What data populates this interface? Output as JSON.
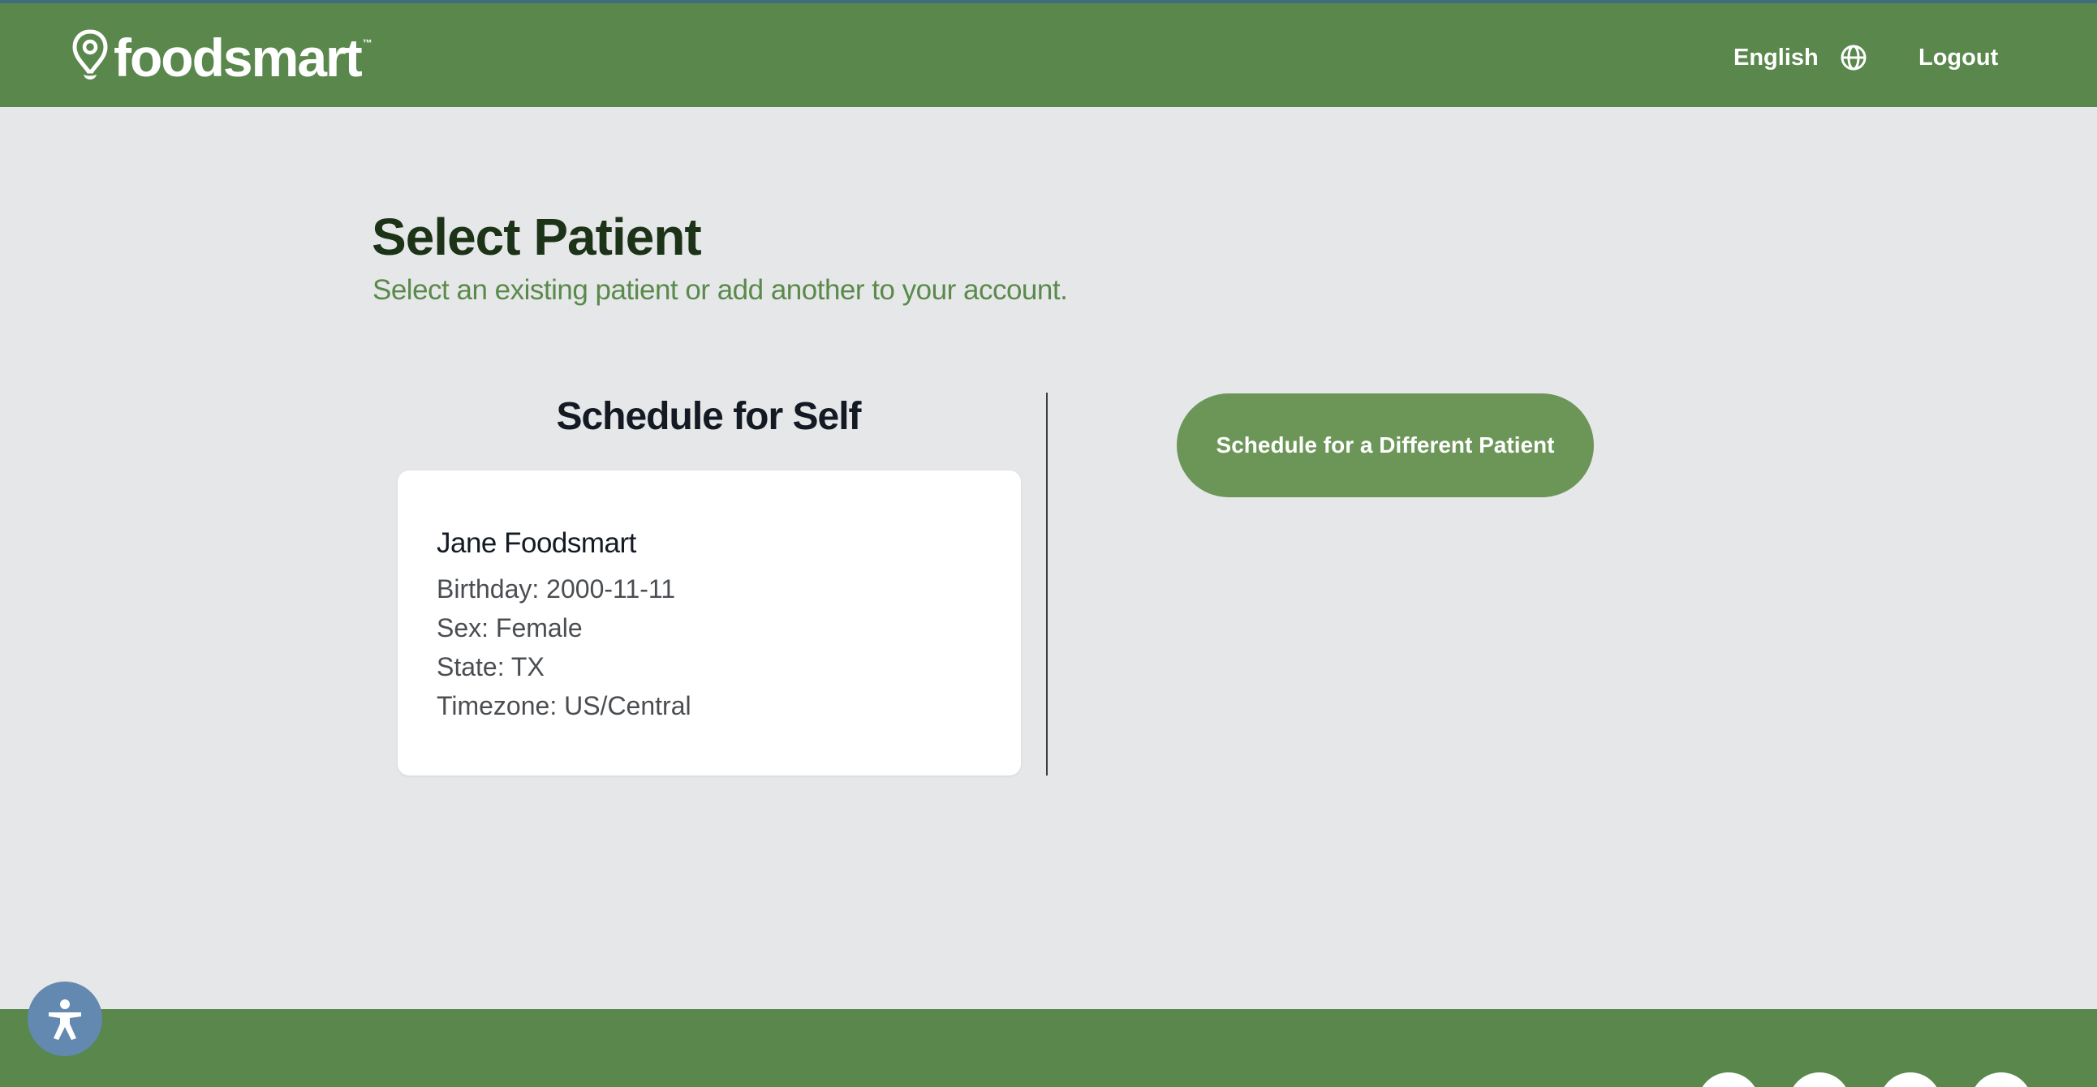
{
  "header": {
    "logo_text": "foodsmart",
    "logo_tm": "™",
    "language_label": "English",
    "logout_label": "Logout"
  },
  "main": {
    "title": "Select Patient",
    "subtitle": "Select an existing patient or add another to your account.",
    "self_section": {
      "heading": "Schedule for Self",
      "patient": {
        "name": "Jane Foodsmart",
        "birthday": "Birthday: 2000-11-11",
        "sex": "Sex: Female",
        "state": "State: TX",
        "timezone": "Timezone: US/Central"
      }
    },
    "different_patient_button": "Schedule for a Different Patient"
  },
  "icons": {
    "logo": "location-pin-icon",
    "language": "globe-icon",
    "accessibility": "accessibility-person-icon"
  },
  "colors": {
    "brand_green": "#59874c",
    "button_green": "#6b9657",
    "title_dark_green": "#1c3317",
    "subtitle_green": "#5a8a4b",
    "page_background": "#e6e7e9",
    "accessibility_blue": "#6389b1"
  }
}
